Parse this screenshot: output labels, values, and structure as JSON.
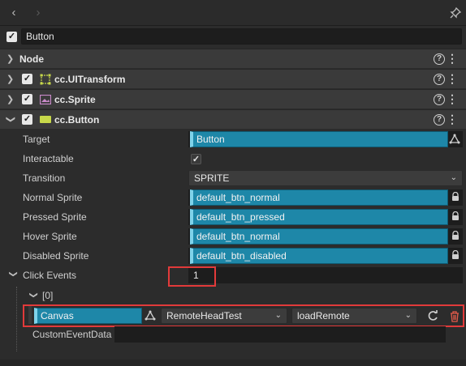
{
  "toolbar": {
    "back_icon": "‹",
    "forward_icon": "›",
    "pin_icon": "pin-icon"
  },
  "node": {
    "name": "Button",
    "enabled": true
  },
  "sections": {
    "node": {
      "label": "Node",
      "help": "?",
      "menu": "⋮"
    },
    "transform": {
      "label": "cc.UITransform",
      "help": "?",
      "menu": "⋮"
    },
    "sprite": {
      "label": "cc.Sprite",
      "help": "?",
      "menu": "⋮"
    },
    "button": {
      "label": "cc.Button",
      "help": "?",
      "menu": "⋮"
    }
  },
  "props": {
    "target": {
      "label": "Target",
      "value": "Button"
    },
    "interactable": {
      "label": "Interactable",
      "checked": true
    },
    "transition": {
      "label": "Transition",
      "value": "SPRITE"
    },
    "normal_sprite": {
      "label": "Normal Sprite",
      "value": "default_btn_normal"
    },
    "pressed_sprite": {
      "label": "Pressed Sprite",
      "value": "default_btn_pressed"
    },
    "hover_sprite": {
      "label": "Hover Sprite",
      "value": "default_btn_normal"
    },
    "disabled_sprite": {
      "label": "Disabled Sprite",
      "value": "default_btn_disabled"
    },
    "click_events": {
      "label": "Click Events",
      "value": "1"
    }
  },
  "event": {
    "index_label": "[0]",
    "target": "Canvas",
    "component": "RemoteHeadTest",
    "handler": "loadRemote",
    "custom_data_label": "CustomEventData",
    "custom_data_value": ""
  },
  "colors": {
    "highlight": "#e23a3a",
    "asset": "#1e87a8"
  }
}
